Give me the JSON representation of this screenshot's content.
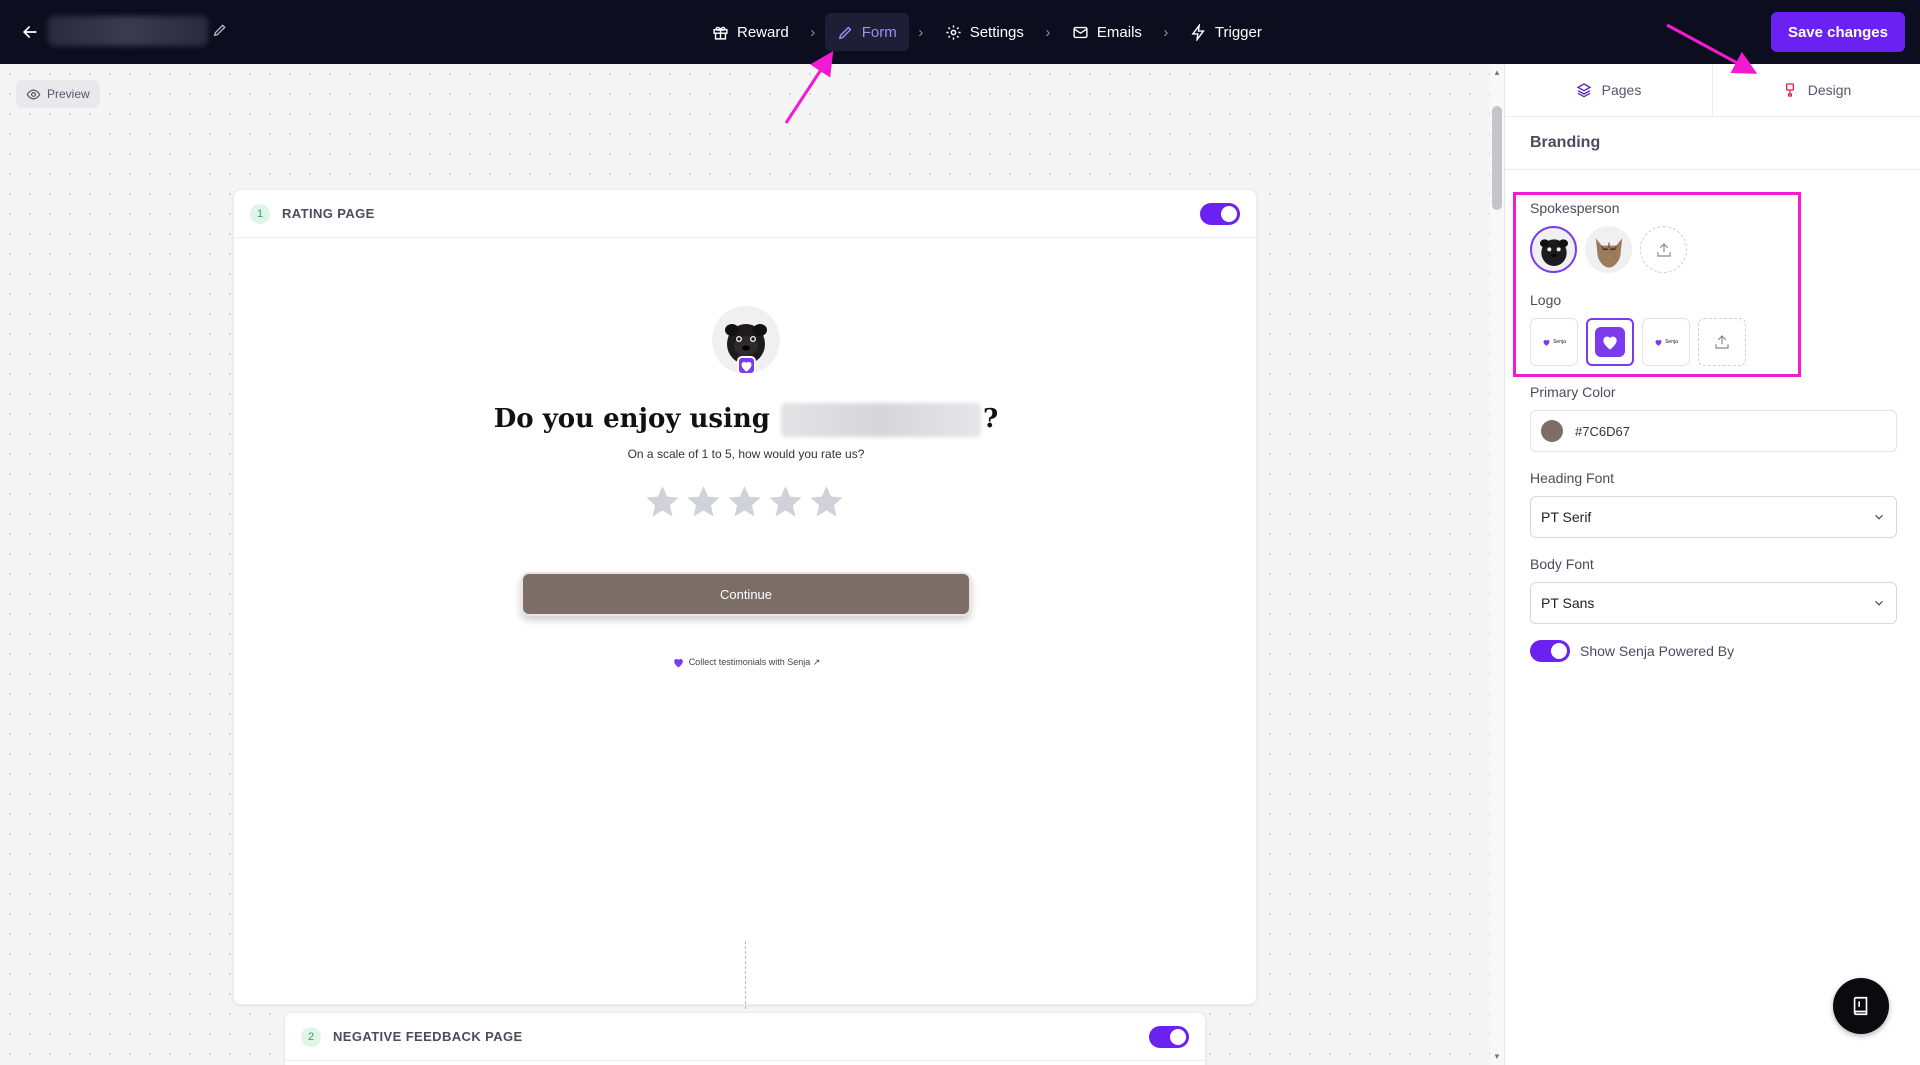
{
  "topbar": {
    "steps": [
      {
        "label": "Reward",
        "icon": "gift-icon"
      },
      {
        "label": "Form",
        "icon": "pencil-icon",
        "active": true
      },
      {
        "label": "Settings",
        "icon": "gear-icon"
      },
      {
        "label": "Emails",
        "icon": "mail-icon"
      },
      {
        "label": "Trigger",
        "icon": "bolt-icon"
      }
    ],
    "save_label": "Save changes"
  },
  "canvas": {
    "preview_label": "Preview",
    "page1": {
      "number": "1",
      "title": "RATING PAGE",
      "question_start": "Do you enjoy using",
      "question_end": "?",
      "subtitle": "On a scale of 1 to 5, how would you rate us?",
      "stars": 5,
      "continue_label": "Continue",
      "collect_label": "Collect testimonials with Senja ↗"
    },
    "page2": {
      "number": "2",
      "title": "NEGATIVE FEEDBACK PAGE"
    }
  },
  "panel": {
    "tabs": [
      {
        "label": "Pages",
        "icon": "layers-icon"
      },
      {
        "label": "Design",
        "icon": "brush-icon"
      }
    ],
    "section_title": "Branding",
    "spokesperson_label": "Spokesperson",
    "logo_label": "Logo",
    "logo_text": "Senja",
    "primary_color_label": "Primary Color",
    "primary_color_value": "#7C6D67",
    "heading_font_label": "Heading Font",
    "heading_font_value": "PT Serif",
    "body_font_label": "Body Font",
    "body_font_value": "PT Sans",
    "powered_by_label": "Show Senja Powered By"
  },
  "colors": {
    "accent": "#6b21f2",
    "primary": "#7c6d67",
    "annotation": "#f21bd2",
    "topbar": "#0c0d1f"
  }
}
